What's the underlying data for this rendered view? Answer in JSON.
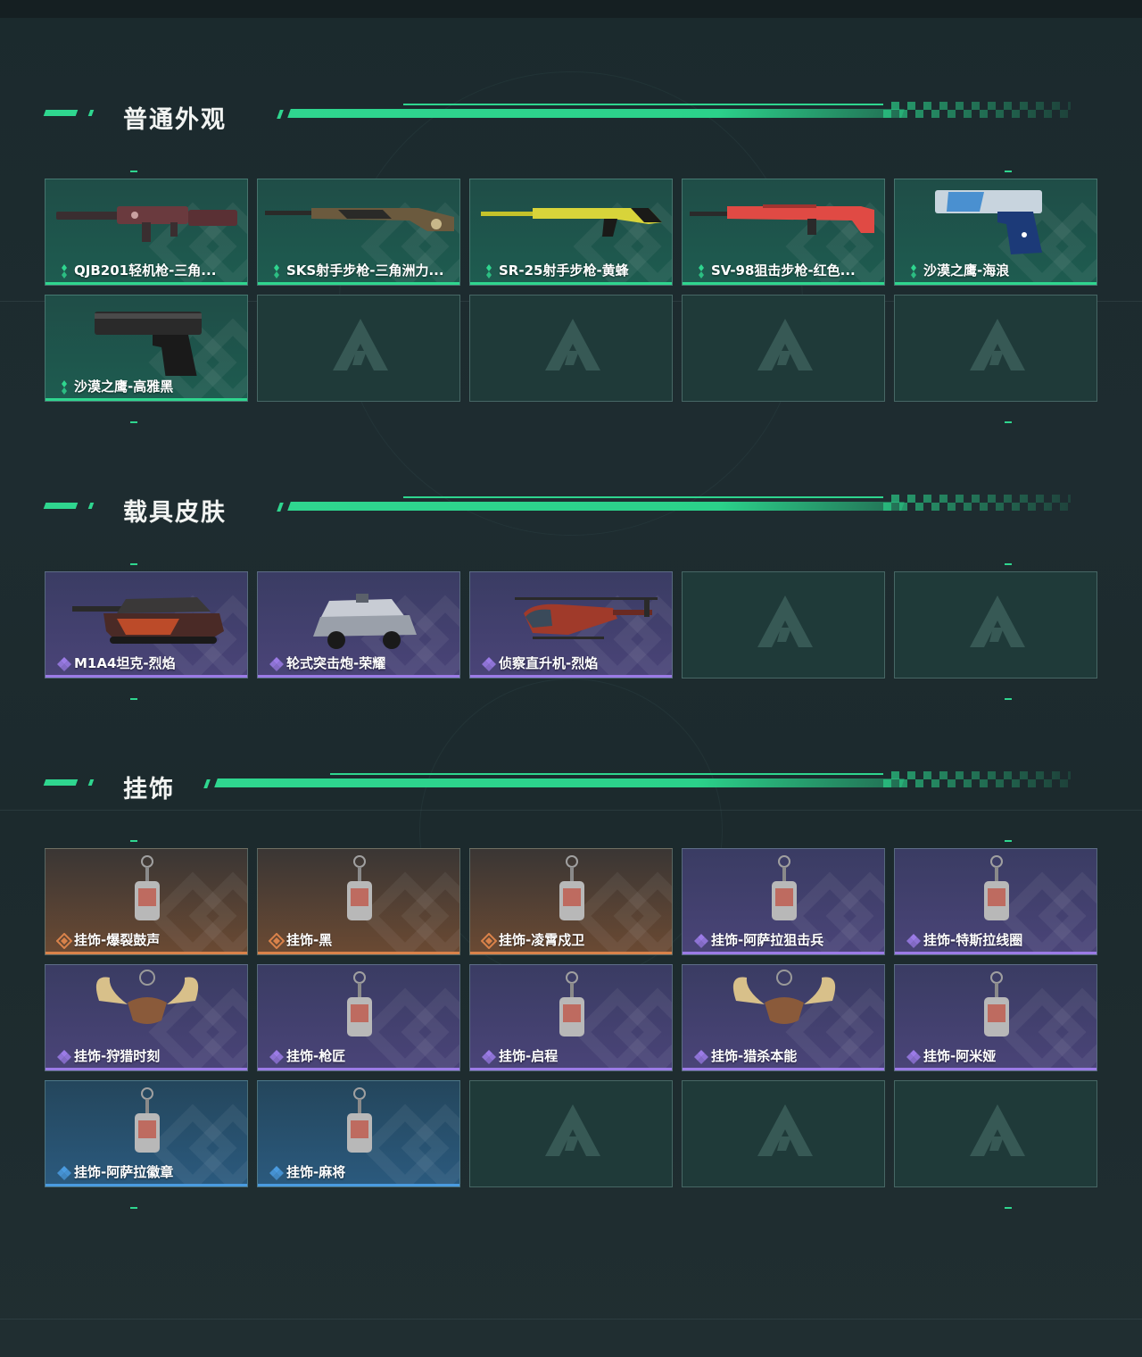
{
  "sections": [
    {
      "title": "普通外观",
      "items": [
        {
          "label": "QJB201轻机枪-三角...",
          "rarity": "green",
          "icon": "machine-gun-icon"
        },
        {
          "label": "SKS射手步枪-三角洲力...",
          "rarity": "green",
          "icon": "rifle-icon"
        },
        {
          "label": "SR-25射手步枪-黄蜂",
          "rarity": "green",
          "icon": "rifle-yellow-icon"
        },
        {
          "label": "SV-98狙击步枪-红色...",
          "rarity": "green",
          "icon": "sniper-rifle-icon"
        },
        {
          "label": "沙漠之鹰-海浪",
          "rarity": "green",
          "icon": "pistol-blue-icon"
        },
        {
          "label": "沙漠之鹰-高雅黑",
          "rarity": "green",
          "icon": "pistol-black-icon"
        }
      ],
      "empty_slots": 4
    },
    {
      "title": "载具皮肤",
      "items": [
        {
          "label": "M1A4坦克-烈焰",
          "rarity": "purple",
          "icon": "tank-icon"
        },
        {
          "label": "轮式突击炮-荣耀",
          "rarity": "purple",
          "icon": "armored-vehicle-icon"
        },
        {
          "label": "侦察直升机-烈焰",
          "rarity": "purple",
          "icon": "helicopter-icon"
        }
      ],
      "empty_slots": 2
    },
    {
      "title": "挂饰",
      "items": [
        {
          "label": "挂饰-爆裂鼓声",
          "rarity": "orange",
          "icon": "charm-icon"
        },
        {
          "label": "挂饰-黑",
          "rarity": "orange",
          "icon": "charm-tag-icon"
        },
        {
          "label": "挂饰-凌霄戍卫",
          "rarity": "orange",
          "icon": "charm-figure-icon"
        },
        {
          "label": "挂饰-阿萨拉狙击兵",
          "rarity": "purple",
          "icon": "charm-soldier-icon"
        },
        {
          "label": "挂饰-特斯拉线圈",
          "rarity": "purple",
          "icon": "charm-coil-icon"
        },
        {
          "label": "挂饰-狩猎时刻",
          "rarity": "purple",
          "icon": "charm-antler-icon"
        },
        {
          "label": "挂饰-枪匠",
          "rarity": "purple",
          "icon": "charm-dogtag-icon"
        },
        {
          "label": "挂饰-启程",
          "rarity": "purple",
          "icon": "charm-emblem-icon"
        },
        {
          "label": "挂饰-猎杀本能",
          "rarity": "purple",
          "icon": "charm-antler-icon"
        },
        {
          "label": "挂饰-阿米娅",
          "rarity": "purple",
          "icon": "charm-bird-icon"
        },
        {
          "label": "挂饰-阿萨拉徽章",
          "rarity": "blue",
          "icon": "charm-medal-icon"
        },
        {
          "label": "挂饰-麻将",
          "rarity": "blue",
          "icon": "charm-mahjong-icon"
        }
      ],
      "empty_slots": 3
    }
  ],
  "colors": {
    "accent": "#2fd68f",
    "rarity_green": "#2fd68f",
    "rarity_purple": "#9b7be6",
    "rarity_orange": "#d9824a",
    "rarity_blue": "#4a9be0"
  }
}
